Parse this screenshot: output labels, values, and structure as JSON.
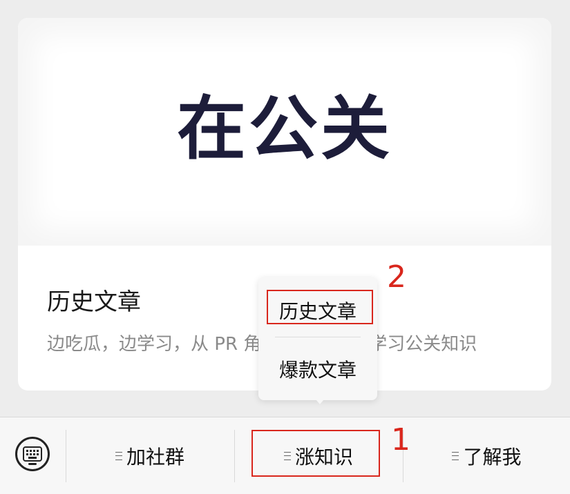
{
  "article_card": {
    "cover_text": "在公关",
    "title": "历史文章",
    "description": "边吃瓜，边学习，从 PR 角度，从实践中学习公关知识"
  },
  "popup_menu": {
    "items": [
      {
        "label": "历史文章"
      },
      {
        "label": "爆款文章"
      }
    ]
  },
  "bottom_menu": {
    "keyboard_icon": "keyboard-icon",
    "items": [
      {
        "label": "加社群",
        "icon": "menu-list-icon"
      },
      {
        "label": "涨知识",
        "icon": "menu-list-icon"
      },
      {
        "label": "了解我",
        "icon": "menu-list-icon"
      }
    ]
  },
  "annotations": {
    "step_1": "1",
    "step_2": "2",
    "color": "#d9261c"
  }
}
